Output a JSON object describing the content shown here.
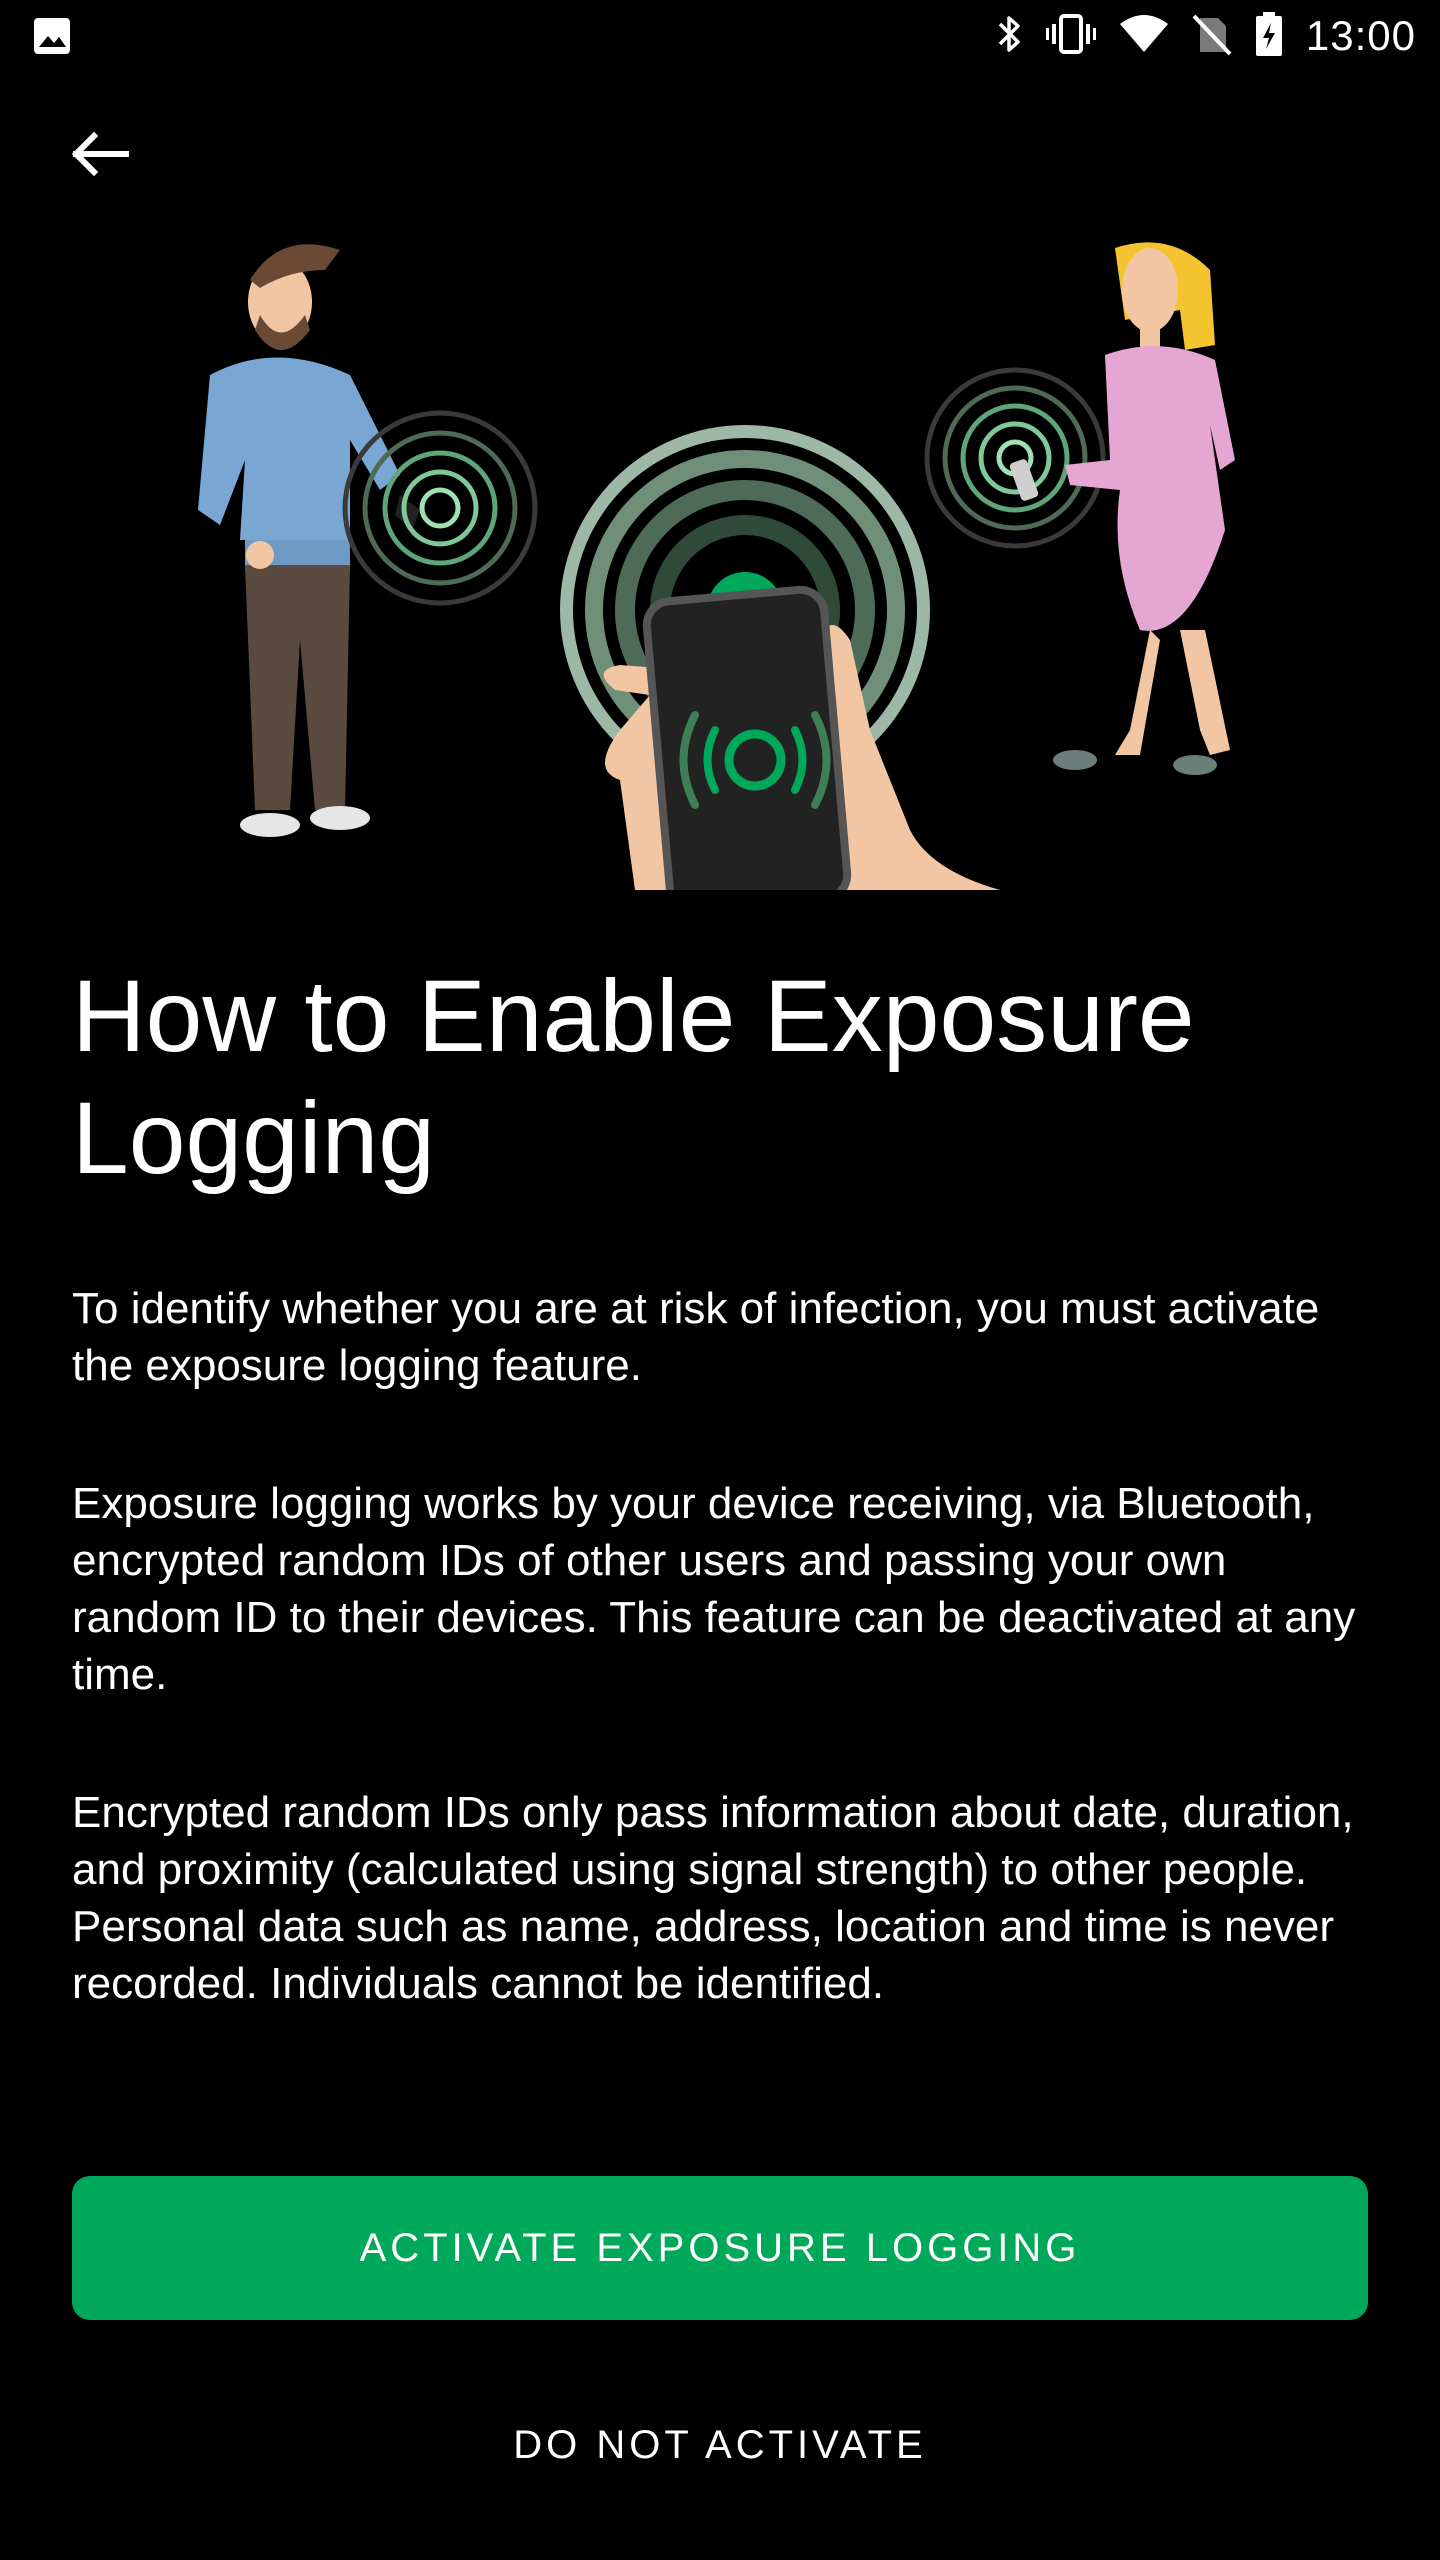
{
  "status_bar": {
    "time": "13:00",
    "icons": [
      "image-icon",
      "bluetooth-icon",
      "vibrate-icon",
      "wifi-icon",
      "no-sim-icon",
      "battery-charging-icon"
    ]
  },
  "nav": {
    "back_icon": "arrow-back-icon"
  },
  "content": {
    "title": "How to Enable Exposure Logging",
    "paragraphs": [
      "To identify whether you are at risk of infection, you must activate the exposure logging feature.",
      "Exposure logging works by your device receiving, via Bluetooth, encrypted random IDs of other users and passing your own random ID to their devices. This feature can be deactivated at any time.",
      "Encrypted random IDs only pass information about date, duration, and proximity (calculated using signal strength) to other people. Personal data such as name, address, location and time is never recorded. Individuals cannot be identified."
    ]
  },
  "actions": {
    "activate_label": "ACTIVATE EXPOSURE LOGGING",
    "decline_label": "DO NOT ACTIVATE"
  },
  "colors": {
    "background": "#000000",
    "accent": "#00a85a",
    "text": "#ffffff"
  }
}
